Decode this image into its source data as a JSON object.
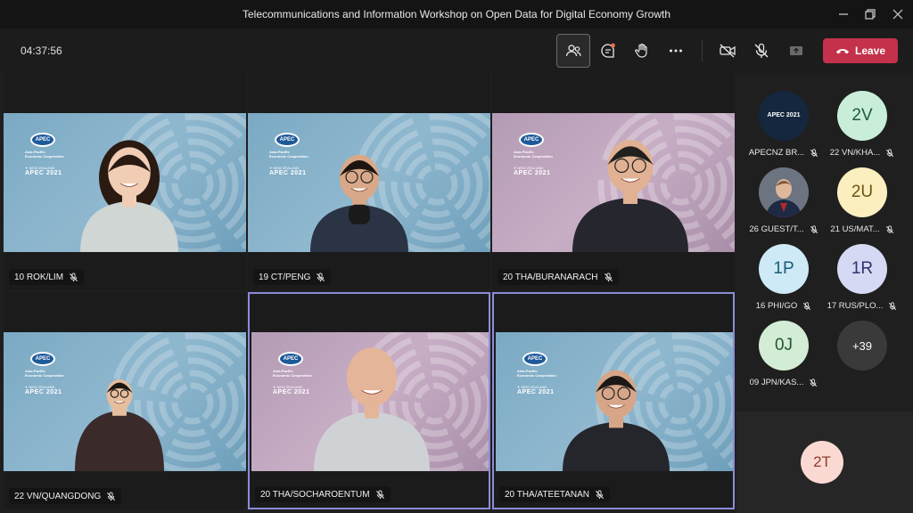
{
  "window": {
    "title": "Telecommunications and Information Workshop on Open Data for Digital Economy Growth"
  },
  "toolbar": {
    "timer": "04:37:56",
    "leave_label": "Leave"
  },
  "branding": {
    "oval": "APEC",
    "org_line1": "Asia-Pacific",
    "org_line2": "Economic Cooperation",
    "country": "NEW ZEALAND",
    "event": "APEC 2021"
  },
  "tiles": [
    {
      "name": "10 ROK/LIM",
      "bg": "blue",
      "speaking": false
    },
    {
      "name": "19 CT/PENG",
      "bg": "blue",
      "speaking": false
    },
    {
      "name": "20 THA/BURANARACH",
      "bg": "pink",
      "speaking": false
    },
    {
      "name": "22 VN/QUANGDONG",
      "bg": "blue",
      "speaking": false
    },
    {
      "name": "20 THA/SOCHAROENTUM",
      "bg": "pink",
      "speaking": true
    },
    {
      "name": "20 THA/ATEETANAN",
      "bg": "blue",
      "speaking": true
    }
  ],
  "participants": [
    {
      "initials": "",
      "name": "APECNZ BR...",
      "bg": "#14273e",
      "fg": "#ffffff",
      "logo_text": "APEC 2021"
    },
    {
      "initials": "2V",
      "name": "22 VN/KHA...",
      "bg": "#c8eed9",
      "fg": "#1f5a3a"
    },
    {
      "initials": "",
      "name": "26 GUEST/T...",
      "bg": "#4a5360",
      "fg": "#ffffff"
    },
    {
      "initials": "2U",
      "name": "21 US/MAT...",
      "bg": "#fbefc0",
      "fg": "#6d5413"
    },
    {
      "initials": "1P",
      "name": "16 PHI/GO",
      "bg": "#cdeaf6",
      "fg": "#1b5a78"
    },
    {
      "initials": "1R",
      "name": "17 RUS/PLO...",
      "bg": "#d6d9f4",
      "fg": "#2c3270"
    },
    {
      "initials": "0J",
      "name": "09 JPN/KAS...",
      "bg": "#d3ecd6",
      "fg": "#245a2e"
    },
    {
      "initials": "+39",
      "name": "",
      "bg": "#3a3a3a",
      "fg": "#ffffff"
    }
  ],
  "self_view": {
    "initials": "2T",
    "bg": "#fbd9d3",
    "fg": "#8e3b2c"
  }
}
